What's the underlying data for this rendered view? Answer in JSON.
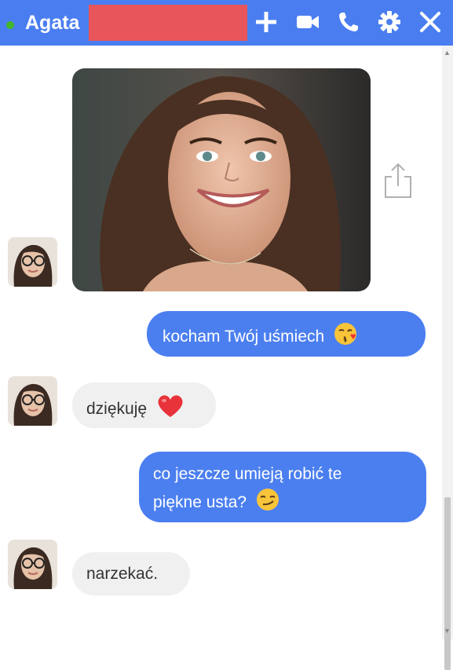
{
  "header": {
    "contact_name": "Agata",
    "online": true,
    "icons": [
      "plus-icon",
      "video-camera-icon",
      "phone-icon",
      "gear-icon",
      "close-icon"
    ],
    "accent_color": "#4a7ef0"
  },
  "messages": [
    {
      "from": "contact",
      "type": "photo",
      "text": ""
    },
    {
      "from": "me",
      "text": "kocham Twój uśmiech",
      "emoji": "kissing-face-emoji"
    },
    {
      "from": "contact",
      "text": "dziękuję",
      "emoji": "red-heart-emoji"
    },
    {
      "from": "me",
      "text_line1": "co jeszcze umieją robić te",
      "text_line2": "piękne usta?",
      "emoji": "smirking-face-emoji"
    },
    {
      "from": "contact",
      "text": "narzekać."
    }
  ],
  "colors": {
    "outgoing_bubble": "#4b7ff0",
    "incoming_bubble": "#f0f0f0"
  }
}
